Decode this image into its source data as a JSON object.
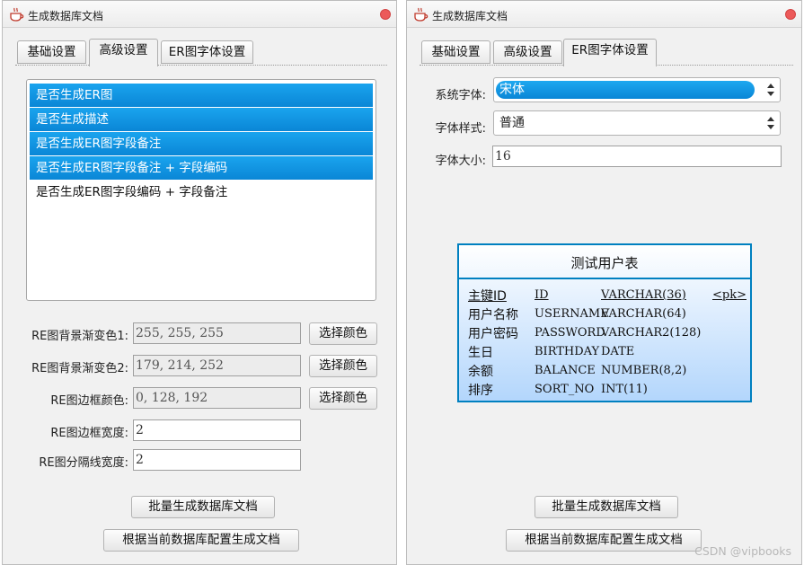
{
  "window_title": "生成数据库文档",
  "tabs": {
    "basic": "基础设置",
    "advanced": "高级设置",
    "er_font": "ER图字体设置"
  },
  "left": {
    "options": [
      {
        "label": "是否生成ER图",
        "selected": true
      },
      {
        "label": "是否生成描述",
        "selected": true
      },
      {
        "label": "是否生成ER图字段备注",
        "selected": true
      },
      {
        "label": "是否生成ER图字段备注 + 字段编码",
        "selected": true
      },
      {
        "label": "是否生成ER图字段编码 + 字段备注",
        "selected": false
      }
    ],
    "bg_color1_label": "RE图背景渐变色1:",
    "bg_color1_value": "255, 255, 255",
    "bg_color2_label": "RE图背景渐变色2:",
    "bg_color2_value": "179, 214, 252",
    "border_color_label": "RE图边框颜色:",
    "border_color_value": "0, 128, 192",
    "border_width_label": "RE图边框宽度:",
    "border_width_value": "2",
    "divider_width_label": "RE图分隔线宽度:",
    "divider_width_value": "2",
    "choose_color_label": "选择颜色"
  },
  "right": {
    "font_label": "系统字体:",
    "font_value": "宋体",
    "style_label": "字体样式:",
    "style_value": "普通",
    "size_label": "字体大小:",
    "size_value": "16",
    "er_preview": {
      "title": "测试用户表",
      "rows": [
        {
          "name": "主键ID",
          "code": "ID",
          "type": "VARCHAR(36)",
          "flag": "<pk>"
        },
        {
          "name": "用户名称",
          "code": "USERNAME",
          "type": "VARCHAR(64)",
          "flag": ""
        },
        {
          "name": "用户密码",
          "code": "PASSWORD",
          "type": "VARCHAR2(128)",
          "flag": ""
        },
        {
          "name": "生日",
          "code": "BIRTHDAY",
          "type": "DATE",
          "flag": ""
        },
        {
          "name": "余额",
          "code": "BALANCE",
          "type": "NUMBER(8,2)",
          "flag": ""
        },
        {
          "name": "排序",
          "code": "SORT_NO",
          "type": "INT(11)",
          "flag": ""
        }
      ]
    }
  },
  "buttons": {
    "batch_generate": "批量生成数据库文档",
    "generate_current": "根据当前数据库配置生成文档"
  },
  "watermark": "CSDN @vipbooks",
  "colors": {
    "selection": "#0a86d6",
    "er_border": "#0080c0",
    "er_gradient_end": "#b3d6fc",
    "close": "#ec5a5a"
  },
  "icons": {
    "app": "coffee-cup-icon",
    "close": "close-icon",
    "combo": "spinner-arrows-icon"
  }
}
